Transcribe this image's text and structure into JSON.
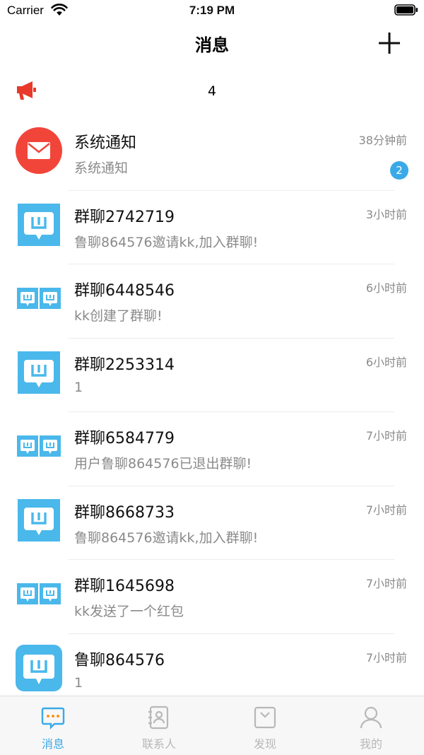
{
  "status_bar": {
    "carrier": "Carrier",
    "time": "7:19 PM"
  },
  "nav": {
    "title": "消息",
    "add_icon": "plus-icon"
  },
  "notice": {
    "icon": "megaphone-icon",
    "count": "4"
  },
  "conversations": [
    {
      "title": "系统通知",
      "subtitle": "系统通知",
      "time": "38分钟前",
      "badge": "2",
      "avatar": "mail-icon"
    },
    {
      "title": "群聊2742719",
      "subtitle": "鲁聊864576邀请kk,加入群聊!",
      "time": "3小时前",
      "avatar": "single-chat-icon"
    },
    {
      "title": "群聊6448546",
      "subtitle": "kk创建了群聊!",
      "time": "6小时前",
      "avatar": "double-chat-icon"
    },
    {
      "title": "群聊2253314",
      "subtitle": "1",
      "time": "6小时前",
      "avatar": "single-chat-icon"
    },
    {
      "title": "群聊6584779",
      "subtitle": "用户鲁聊864576已退出群聊!",
      "time": "7小时前",
      "avatar": "double-chat-icon"
    },
    {
      "title": "群聊8668733",
      "subtitle": "鲁聊864576邀请kk,加入群聊!",
      "time": "7小时前",
      "avatar": "single-chat-icon"
    },
    {
      "title": "群聊1645698",
      "subtitle": "kk发送了一个红包",
      "time": "7小时前",
      "avatar": "double-chat-icon"
    },
    {
      "title": "鲁聊864576",
      "subtitle": "1",
      "time": "7小时前",
      "avatar": "app-chat-icon"
    }
  ],
  "tabs": [
    {
      "label": "消息",
      "icon": "message-icon",
      "active": true
    },
    {
      "label": "联系人",
      "icon": "contacts-icon",
      "active": false
    },
    {
      "label": "发现",
      "icon": "discover-icon",
      "active": false
    },
    {
      "label": "我的",
      "icon": "profile-icon",
      "active": false
    }
  ],
  "colors": {
    "accent": "#3aa9e8",
    "notice_red": "#e8392a",
    "mail_red": "#f2453a",
    "inactive": "#b8b8b8"
  }
}
